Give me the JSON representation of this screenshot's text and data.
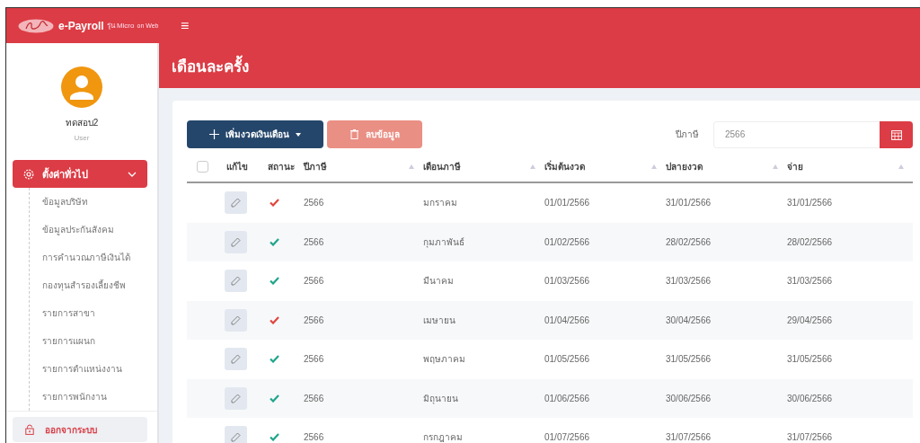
{
  "topbar": {
    "brand": "e-Payroll",
    "edition": "รุ่น Micro",
    "platform": "on Web",
    "menu_glyph": "≡"
  },
  "user": {
    "name": "ทดสอบ2",
    "role": "User"
  },
  "sidebar": {
    "group": {
      "label": "ตั้งค่าทั่วไป",
      "expanded": true,
      "items": [
        {
          "label": "ข้อมูลบริษัท",
          "selected": false
        },
        {
          "label": "ข้อมูลประกันสังคม",
          "selected": false
        },
        {
          "label": "การคำนวณภาษีเงินได้",
          "selected": false
        },
        {
          "label": "กองทุนสำรองเลี้ยงชีพ",
          "selected": false
        },
        {
          "label": "รายการสาขา",
          "selected": false
        },
        {
          "label": "รายการแผนก",
          "selected": false
        },
        {
          "label": "รายการตำแหน่งงาน",
          "selected": false
        },
        {
          "label": "รายการพนักงาน",
          "selected": false
        }
      ]
    },
    "logout": "ออกจากระบบ"
  },
  "page": {
    "title": "เดือนละครั้ง"
  },
  "toolbar": {
    "add_button": "เพิ่มงวดเงินเดือน",
    "delete_button": "ลบข้อมูล",
    "year_label": "ปีภาษี",
    "year_value": "2566"
  },
  "table": {
    "select_all": false,
    "columns": [
      "แก้ไข",
      "สถานะ",
      "ปีภาษี",
      "เดือนภาษี",
      "เริ่มต้นงวด",
      "ปลายงวด",
      "จ่าย"
    ],
    "rows": [
      {
        "ok": false,
        "year": "2566",
        "month": "มกราคม",
        "start": "01/01/2566",
        "end": "31/01/2566",
        "pay": "31/01/2566"
      },
      {
        "ok": true,
        "year": "2566",
        "month": "กุมภาพันธ์",
        "start": "01/02/2566",
        "end": "28/02/2566",
        "pay": "28/02/2566"
      },
      {
        "ok": true,
        "year": "2566",
        "month": "มีนาคม",
        "start": "01/03/2566",
        "end": "31/03/2566",
        "pay": "31/03/2566"
      },
      {
        "ok": false,
        "year": "2566",
        "month": "เมษายน",
        "start": "01/04/2566",
        "end": "30/04/2566",
        "pay": "29/04/2566"
      },
      {
        "ok": true,
        "year": "2566",
        "month": "พฤษภาคม",
        "start": "01/05/2566",
        "end": "31/05/2566",
        "pay": "31/05/2566"
      },
      {
        "ok": true,
        "year": "2566",
        "month": "มิถุนายน",
        "start": "01/06/2566",
        "end": "30/06/2566",
        "pay": "30/06/2566"
      },
      {
        "ok": true,
        "year": "2566",
        "month": "กรกฎาคม",
        "start": "01/07/2566",
        "end": "31/07/2566",
        "pay": "31/07/2566"
      }
    ]
  }
}
